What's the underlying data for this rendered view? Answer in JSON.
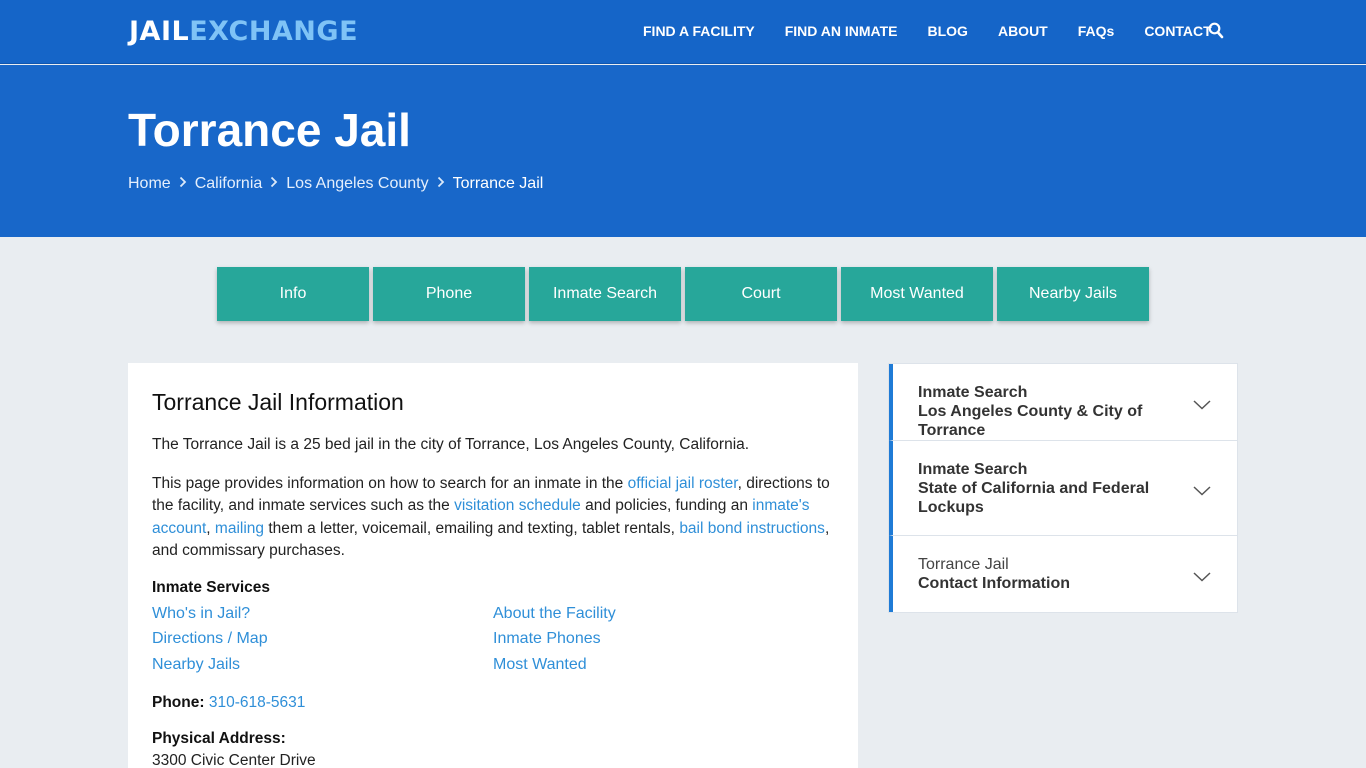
{
  "header": {
    "logo_part1": "JAIL",
    "logo_part2": "EXCHANGE",
    "nav": [
      "FIND A FACILITY",
      "FIND AN INMATE",
      "BLOG",
      "ABOUT",
      "FAQs",
      "CONTACT"
    ]
  },
  "hero": {
    "title": "Torrance Jail",
    "breadcrumbs": [
      "Home",
      "California",
      "Los Angeles County",
      "Torrance Jail"
    ]
  },
  "tabs": [
    "Info",
    "Phone",
    "Inmate Search",
    "Court",
    "Most Wanted",
    "Nearby Jails"
  ],
  "main": {
    "heading": "Torrance Jail Information",
    "intro": "The Torrance Jail is a 25 bed jail in the city of Torrance, Los Angeles County, California.",
    "p2": {
      "t1": "This page provides information on how to search for an inmate in the ",
      "l1": "official jail roster",
      "t2": ", directions to the facility, and inmate services such as the ",
      "l2": "visitation schedule",
      "t3": " and policies, funding an ",
      "l3": "inmate's account",
      "t4": ", ",
      "l4": "mailing",
      "t5": " them a letter, voicemail, emailing and texting, tablet rentals, ",
      "l5": "bail bond instructions",
      "t6": ", and commissary purchases."
    },
    "services_heading": "Inmate Services",
    "services": [
      "Who's in Jail?",
      "About the Facility",
      "Directions / Map",
      "Inmate Phones",
      "Nearby Jails",
      "Most Wanted"
    ],
    "phone_label": "Phone:",
    "phone": "310-618-5631",
    "address_label": "Physical Address:",
    "address_line1": "3300 Civic Center Drive"
  },
  "sidebar": [
    {
      "line1": "Inmate Search",
      "line2": "Los Angeles County & City of Torrance"
    },
    {
      "line1": "Inmate Search",
      "line2": "State of California and Federal Lockups"
    },
    {
      "line1": "Torrance Jail",
      "line2": "Contact Information"
    }
  ],
  "colors": {
    "header_blue": "#1565c8",
    "tab_teal": "#27a79a",
    "link_blue": "#2f8fd8"
  }
}
